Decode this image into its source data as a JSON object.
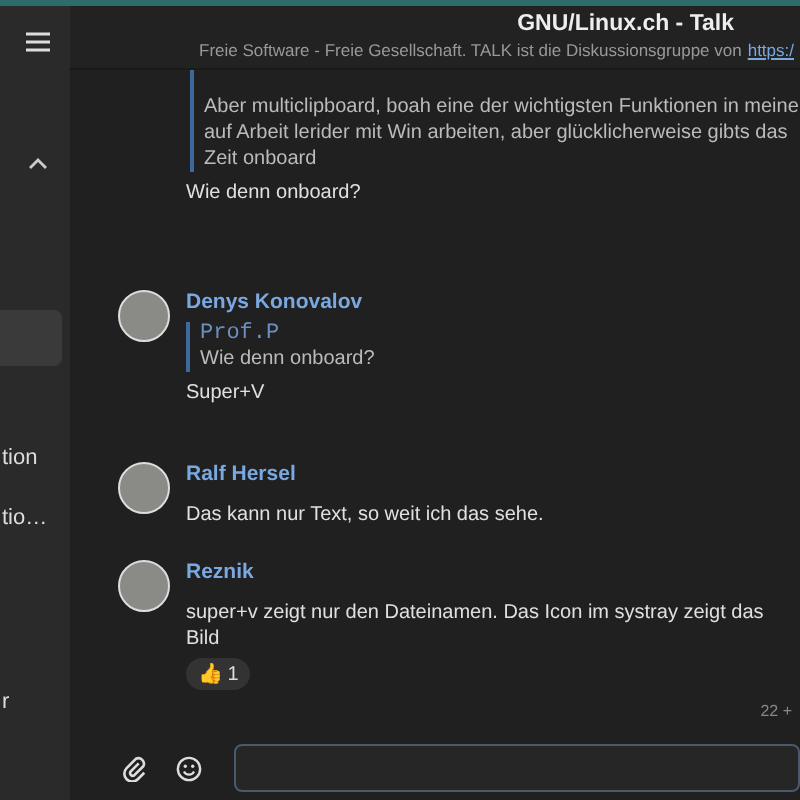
{
  "sidebar": {
    "items": [
      {
        "label": "tion",
        "selected": false
      },
      {
        "label": "tio…",
        "selected": false
      },
      {
        "label": "r",
        "selected": false
      }
    ]
  },
  "header": {
    "title": "GNU/Linux.ch - Talk",
    "subtitle": "Freie Software - Freie Gesellschaft. TALK ist die Diskussionsgruppe von",
    "link": "https:/"
  },
  "messages": [
    {
      "kind": "continued",
      "quote": {
        "lines": [
          "Aber multiclipboard, boah eine der wichtigsten Funktionen in meine",
          "auf Arbeit lerider mit Win arbeiten, aber glücklicherweise gibts das",
          "Zeit onboard"
        ]
      },
      "text": "Wie denn onboard?"
    },
    {
      "kind": "reply",
      "author": "Denys Konovalov",
      "quote": {
        "author": "Prof.P",
        "lines": [
          "Wie denn onboard?"
        ]
      },
      "text": "Super+V"
    },
    {
      "kind": "plain",
      "author": "Ralf Hersel",
      "text": "Das kann nur Text, so weit ich das sehe."
    },
    {
      "kind": "plain",
      "author": "Reznik",
      "text": "super+v zeigt nur den Dateinamen. Das Icon im systray zeigt das Bild",
      "reaction": {
        "emoji": "👍",
        "count": "1"
      },
      "time": "22 +"
    }
  ]
}
